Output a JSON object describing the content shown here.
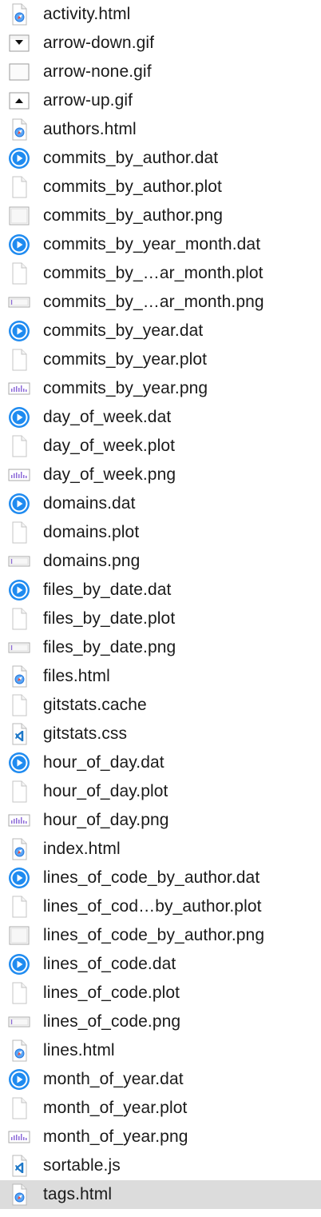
{
  "finder": {
    "files": [
      {
        "name": "activity.html",
        "icon": "safari-html-icon"
      },
      {
        "name": "arrow-down.gif",
        "icon": "gif-arrow-down-icon"
      },
      {
        "name": "arrow-none.gif",
        "icon": "gif-blank-icon"
      },
      {
        "name": "arrow-up.gif",
        "icon": "gif-arrow-up-icon"
      },
      {
        "name": "authors.html",
        "icon": "safari-html-icon"
      },
      {
        "name": "commits_by_author.dat",
        "icon": "quicktime-dat-icon"
      },
      {
        "name": "commits_by_author.plot",
        "icon": "blank-document-icon"
      },
      {
        "name": "commits_by_author.png",
        "icon": "png-thumbnail-icon"
      },
      {
        "name": "commits_by_year_month.dat",
        "icon": "quicktime-dat-icon"
      },
      {
        "name": "commits_by_…ar_month.plot",
        "icon": "blank-document-icon"
      },
      {
        "name": "commits_by_…ar_month.png",
        "icon": "png-wide-thumbnail-icon"
      },
      {
        "name": "commits_by_year.dat",
        "icon": "quicktime-dat-icon"
      },
      {
        "name": "commits_by_year.plot",
        "icon": "blank-document-icon"
      },
      {
        "name": "commits_by_year.png",
        "icon": "png-bars-thumbnail-icon"
      },
      {
        "name": "day_of_week.dat",
        "icon": "quicktime-dat-icon"
      },
      {
        "name": "day_of_week.plot",
        "icon": "blank-document-icon"
      },
      {
        "name": "day_of_week.png",
        "icon": "png-bars-thumbnail-icon"
      },
      {
        "name": "domains.dat",
        "icon": "quicktime-dat-icon"
      },
      {
        "name": "domains.plot",
        "icon": "blank-document-icon"
      },
      {
        "name": "domains.png",
        "icon": "png-wide-thumbnail-icon"
      },
      {
        "name": "files_by_date.dat",
        "icon": "quicktime-dat-icon"
      },
      {
        "name": "files_by_date.plot",
        "icon": "blank-document-icon"
      },
      {
        "name": "files_by_date.png",
        "icon": "png-wide-thumbnail-icon"
      },
      {
        "name": "files.html",
        "icon": "safari-html-icon"
      },
      {
        "name": "gitstats.cache",
        "icon": "blank-document-icon"
      },
      {
        "name": "gitstats.css",
        "icon": "vscode-document-icon"
      },
      {
        "name": "hour_of_day.dat",
        "icon": "quicktime-dat-icon"
      },
      {
        "name": "hour_of_day.plot",
        "icon": "blank-document-icon"
      },
      {
        "name": "hour_of_day.png",
        "icon": "png-bars-thumbnail-icon"
      },
      {
        "name": "index.html",
        "icon": "safari-html-icon"
      },
      {
        "name": "lines_of_code_by_author.dat",
        "icon": "quicktime-dat-icon"
      },
      {
        "name": "lines_of_cod…by_author.plot",
        "icon": "blank-document-icon"
      },
      {
        "name": "lines_of_code_by_author.png",
        "icon": "png-thumbnail-icon"
      },
      {
        "name": "lines_of_code.dat",
        "icon": "quicktime-dat-icon"
      },
      {
        "name": "lines_of_code.plot",
        "icon": "blank-document-icon"
      },
      {
        "name": "lines_of_code.png",
        "icon": "png-wide-thumbnail-icon"
      },
      {
        "name": "lines.html",
        "icon": "safari-html-icon"
      },
      {
        "name": "month_of_year.dat",
        "icon": "quicktime-dat-icon"
      },
      {
        "name": "month_of_year.plot",
        "icon": "blank-document-icon"
      },
      {
        "name": "month_of_year.png",
        "icon": "png-bars-thumbnail-icon"
      },
      {
        "name": "sortable.js",
        "icon": "vscode-document-icon"
      },
      {
        "name": "tags.html",
        "icon": "safari-html-icon",
        "selected": true
      }
    ]
  },
  "colors": {
    "selection": "#dcdcdc",
    "text": "#1a1a1a",
    "quicktime_blue": "#1f8bf0",
    "safari_blue": "#2f7fe0",
    "vscode_blue": "#1e78c8",
    "thumb_purple": "#8c6ad8"
  }
}
